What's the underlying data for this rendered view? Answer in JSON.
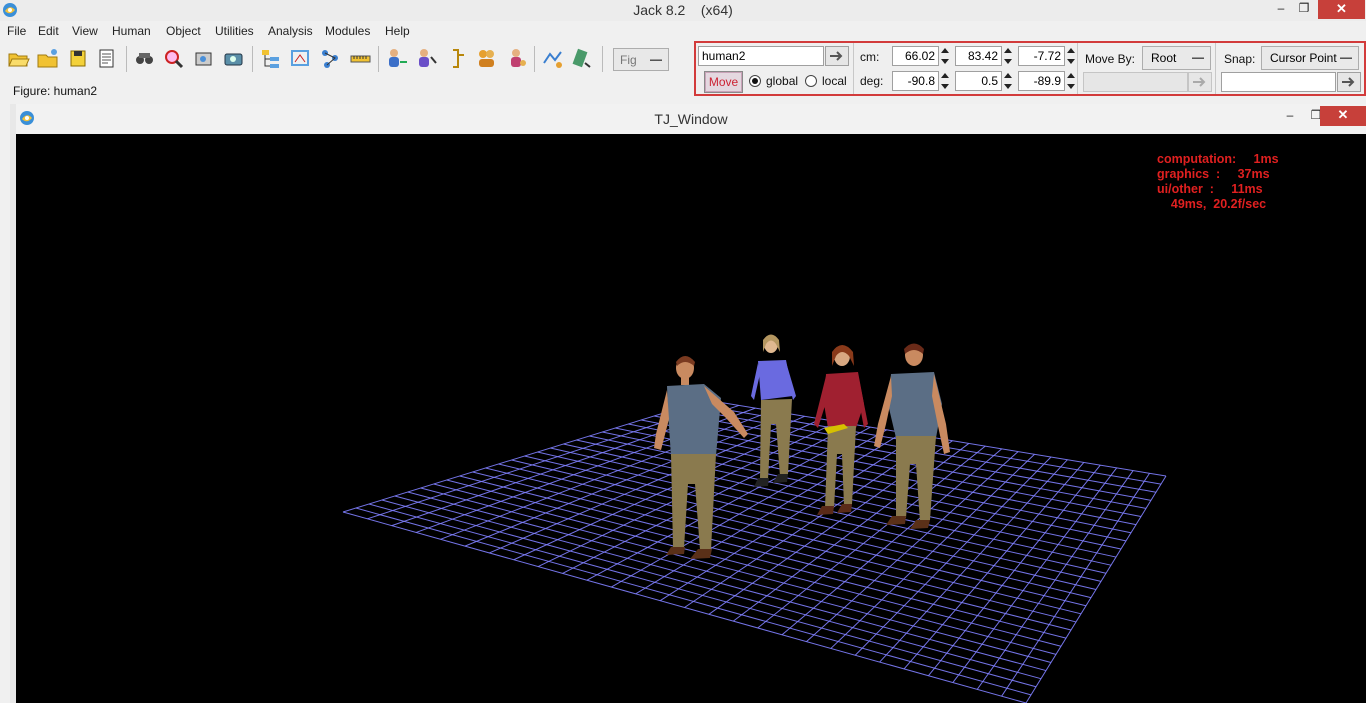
{
  "window": {
    "title": "Jack 8.2",
    "arch": "(x64)",
    "minimize": "–",
    "maximize": "❐",
    "close": "✕"
  },
  "menu": [
    "File",
    "Edit",
    "View",
    "Human",
    "Object",
    "Utilities",
    "Analysis",
    "Modules",
    "Help"
  ],
  "toolbar": {
    "figure_select": "Fig",
    "icons": [
      "open-folder-icon",
      "new-folder-icon",
      "save-icon",
      "script-icon",
      "binoculars-icon",
      "magnifier-icon",
      "camera-view-icon",
      "camera-icon",
      "hierarchy-icon",
      "scene-bounds-icon",
      "nodes-icon",
      "ruler-icon",
      "human-add-icon",
      "human-edit-icon",
      "posture-icon",
      "group-icon",
      "figure-props-icon",
      "animation-icon",
      "inspect-icon"
    ]
  },
  "status": {
    "figure_label": "Figure: human2"
  },
  "controls": {
    "object_name": "human2",
    "move_label": "Move",
    "global_label": "global",
    "local_label": "local",
    "coord_mode": "global",
    "cm_label": "cm:",
    "deg_label": "deg:",
    "cm_values": [
      "66.02",
      "83.42",
      "-7.72"
    ],
    "deg_values": [
      "-90.8",
      "0.5",
      "-89.9"
    ],
    "move_by_label": "Move By:",
    "move_by_value": "Root",
    "snap_label": "Snap:",
    "snap_value": "Cursor Point",
    "snap_field": ""
  },
  "tj_window": {
    "title": "TJ_Window",
    "minimize": "–",
    "maximize": "❐",
    "close": "✕"
  },
  "stats": {
    "line1": "computation:     1ms",
    "line2": "graphics  :     37ms",
    "line3": "ui/other  :     11ms",
    "line4": "    49ms,  20.2f/sec"
  },
  "colors": {
    "accent_red": "#d23b3b",
    "grid": "#8080ff",
    "stats_text": "#e02020"
  }
}
